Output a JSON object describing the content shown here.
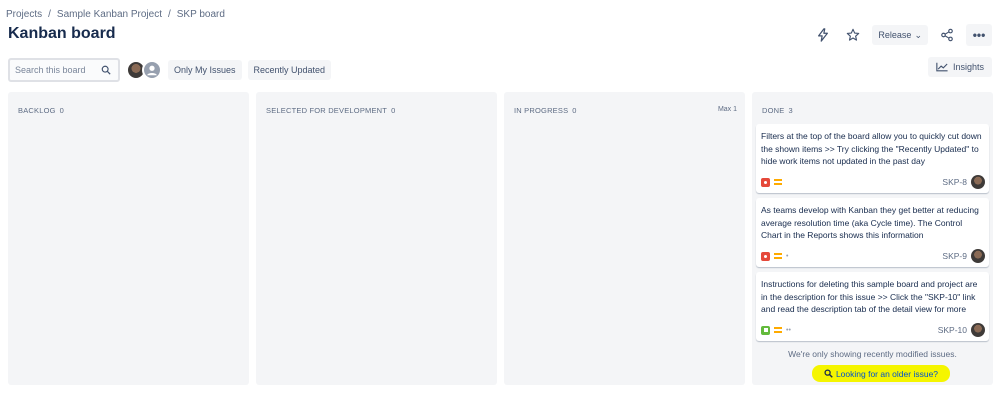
{
  "breadcrumb": [
    "Projects",
    "Sample Kanban Project",
    "SKP board"
  ],
  "page_title": "Kanban board",
  "header": {
    "release_label": "Release",
    "icons": [
      "lightning-icon",
      "star-icon",
      "share-icon",
      "more-icon"
    ]
  },
  "toolbar": {
    "search_placeholder": "Search this board",
    "filters": [
      "Only My Issues",
      "Recently Updated"
    ],
    "insights_label": "Insights"
  },
  "columns": [
    {
      "name": "BACKLOG",
      "count": "0",
      "max": ""
    },
    {
      "name": "SELECTED FOR DEVELOPMENT",
      "count": "0",
      "max": ""
    },
    {
      "name": "IN PROGRESS",
      "count": "0",
      "max": "Max 1"
    },
    {
      "name": "DONE",
      "count": "3",
      "max": ""
    }
  ],
  "done_cards": [
    {
      "summary": "Filters at the top of the board allow you to quickly cut down the shown items >> Try clicking the \"Recently Updated\" to hide work items not updated in the past day",
      "type": "bug",
      "estimate": "",
      "key": "SKP-8"
    },
    {
      "summary": "As teams develop with Kanban they get better at reducing average resolution time (aka Cycle time). The Control Chart in the Reports shows this information",
      "type": "bug",
      "estimate": "•",
      "key": "SKP-9"
    },
    {
      "summary": "Instructions for deleting this sample board and project are in the description for this issue >> Click the \"SKP-10\" link and read the description tab of the detail view for more",
      "type": "story",
      "estimate": "••",
      "key": "SKP-10"
    }
  ],
  "notice": "We're only showing recently modified issues.",
  "older_issue_link": "Looking for an older issue?",
  "colors": {
    "bug": "#e5493a",
    "story": "#63ba3c",
    "priority_medium": "#ffab00",
    "highlight": "#f5f500",
    "link": "#0052cc"
  }
}
